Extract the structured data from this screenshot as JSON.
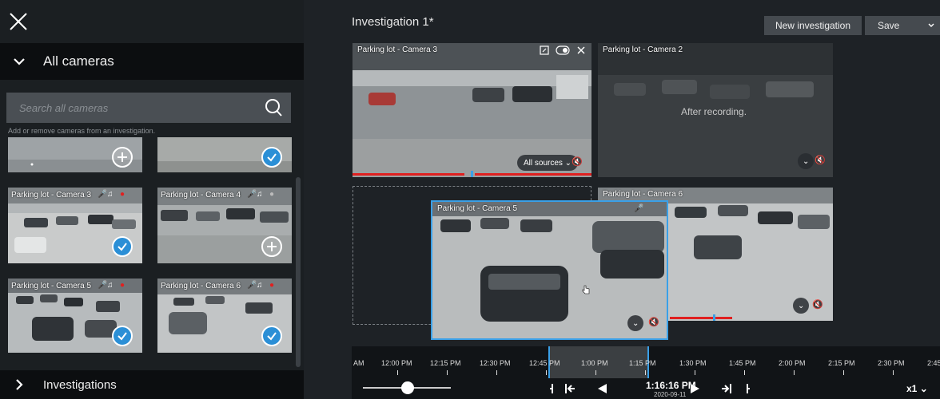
{
  "left_panel": {
    "all_cameras_label": "All cameras",
    "search_placeholder": "Search all cameras",
    "hint": "Add or remove cameras from an investigation.",
    "thumbnails": [
      {
        "label": "",
        "state": "add"
      },
      {
        "label": "",
        "state": "selected"
      },
      {
        "label": "Parking lot - Camera 3",
        "state": "selected",
        "recording": true
      },
      {
        "label": "Parking lot - Camera 4",
        "state": "add",
        "recording": false
      },
      {
        "label": "Parking lot - Camera 5",
        "state": "selected",
        "recording": true
      },
      {
        "label": "Parking lot - Camera 6",
        "state": "selected",
        "recording": true
      }
    ],
    "investigations_label": "Investigations"
  },
  "header": {
    "title": "Investigation 1*",
    "new_investigation": "New investigation",
    "save": "Save"
  },
  "cameras": {
    "cam3": {
      "label": "Parking lot - Camera 3",
      "sources": "All sources"
    },
    "cam2": {
      "label": "Parking lot - Camera 2",
      "status": "After recording."
    },
    "cam6": {
      "label": "Parking lot - Camera 6"
    },
    "cam5": {
      "label": "Parking lot - Camera 5"
    }
  },
  "timeline": {
    "ticks": [
      "AM",
      "12:00 PM",
      "12:15 PM",
      "12:30 PM",
      "12:45 PM",
      "1:00 PM",
      "1:15 PM",
      "1:30 PM",
      "1:45 PM",
      "2:00 PM",
      "2:15 PM",
      "2:30 PM",
      "2:45"
    ],
    "current_time": "1:16:16 PM",
    "current_date": "2020-09-11",
    "speed": "x1"
  },
  "colors": {
    "accent": "#3aa0e8",
    "check": "#2b8fd6",
    "record": "#e02020"
  }
}
